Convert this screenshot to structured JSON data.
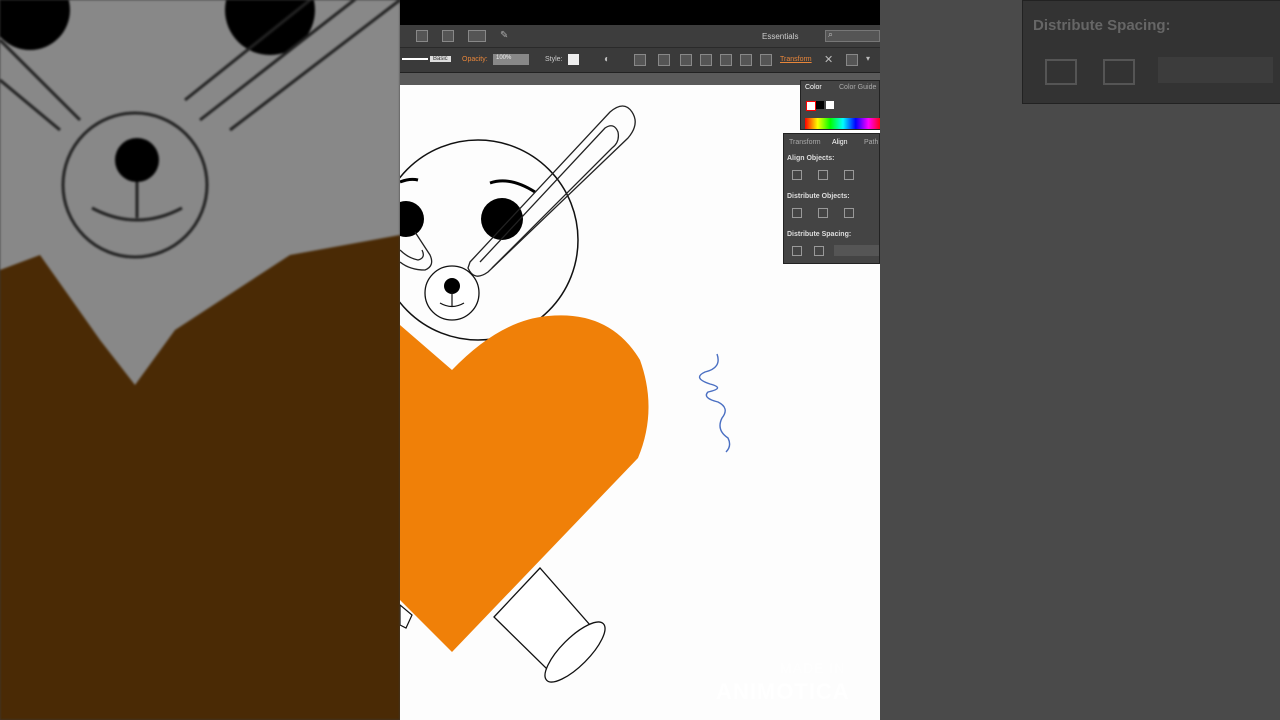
{
  "app": {
    "workspace": "Essentials",
    "control_bar": {
      "stroke_label": "Basic",
      "opacity_label": "Opacity:",
      "opacity_value": "100%",
      "style_label": "Style:",
      "transform_label": "Transform"
    }
  },
  "color_panel": {
    "tabs": [
      "Color",
      "Color Guide"
    ]
  },
  "align_panel": {
    "tabs": [
      "Transform",
      "Align",
      "Path"
    ],
    "align_objects_label": "Align Objects:",
    "distribute_objects_label": "Distribute Objects:",
    "distribute_spacing_label": "Distribute Spacing:"
  },
  "background_zoom": {
    "panel_label": "Distribute Spacing:"
  },
  "watermark": {
    "line1": "MADE IN",
    "line2": "ANIMOTICA"
  },
  "colors": {
    "heart": "#f08008",
    "toolbar": "#3a3a3a",
    "panel": "#444444",
    "accent_text": "#e8863a",
    "squiggle": "#4a6fc2"
  }
}
